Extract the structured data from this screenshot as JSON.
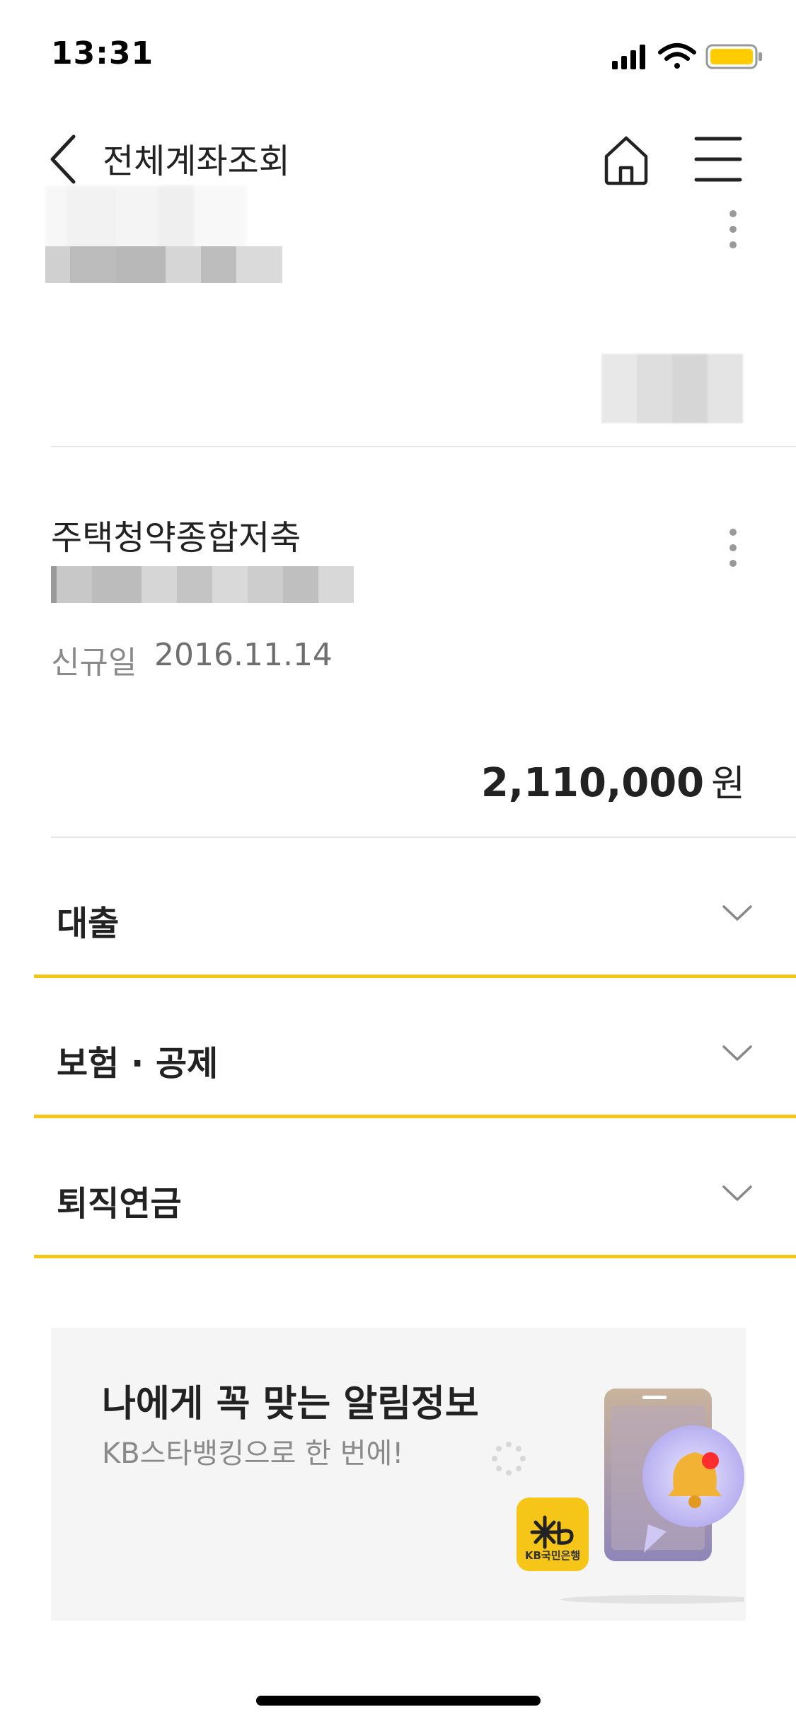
{
  "status_bar": {
    "time": "13:31"
  },
  "header": {
    "title": "전체계좌조회"
  },
  "account": {
    "name": "주택청약종합저축",
    "new_date_label": "신규일",
    "new_date_value": "2016.11.14",
    "balance_amount": "2,110,000",
    "balance_unit": "원"
  },
  "sections": [
    {
      "label": "대출"
    },
    {
      "label": "보험 · 공제"
    },
    {
      "label": "퇴직연금"
    }
  ],
  "banner": {
    "title": "나에게 꼭 맞는 알림정보",
    "subtitle": "KB스타뱅킹으로 한 번에!",
    "logo_text": "KB국민은행"
  },
  "colors": {
    "accent": "#f5c518",
    "battery": "#ffcc00"
  }
}
